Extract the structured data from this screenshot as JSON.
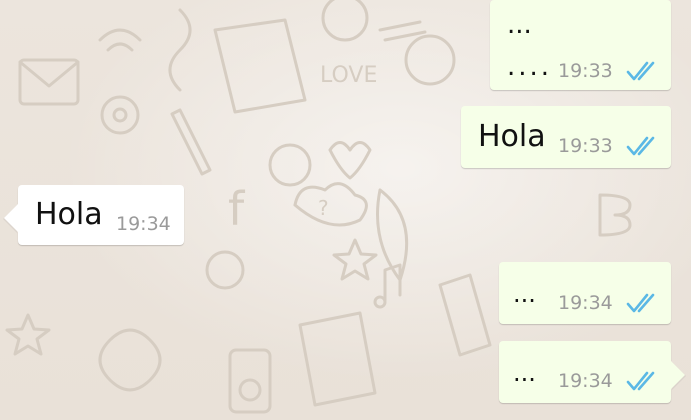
{
  "conversation": {
    "messages": [
      {
        "direction": "outgoing",
        "lines": [
          "...",
          "...."
        ],
        "time": "19:33",
        "status": "read-double-check-icon"
      },
      {
        "direction": "outgoing",
        "text": "Hola",
        "time": "19:33",
        "status": "read-double-check-icon"
      },
      {
        "direction": "incoming",
        "text": "Hola",
        "time": "19:34"
      },
      {
        "direction": "outgoing",
        "text": "...",
        "time": "19:34",
        "status": "read-double-check-icon"
      },
      {
        "direction": "outgoing",
        "text": "...",
        "time": "19:34",
        "status": "read-double-check-icon"
      }
    ]
  },
  "colors": {
    "background": "#e6ddd4",
    "outgoing_bubble": "#f6ffe8",
    "incoming_bubble": "#ffffff",
    "read_ticks": "#5bb8e5",
    "timestamp": "#9a9a9a"
  }
}
